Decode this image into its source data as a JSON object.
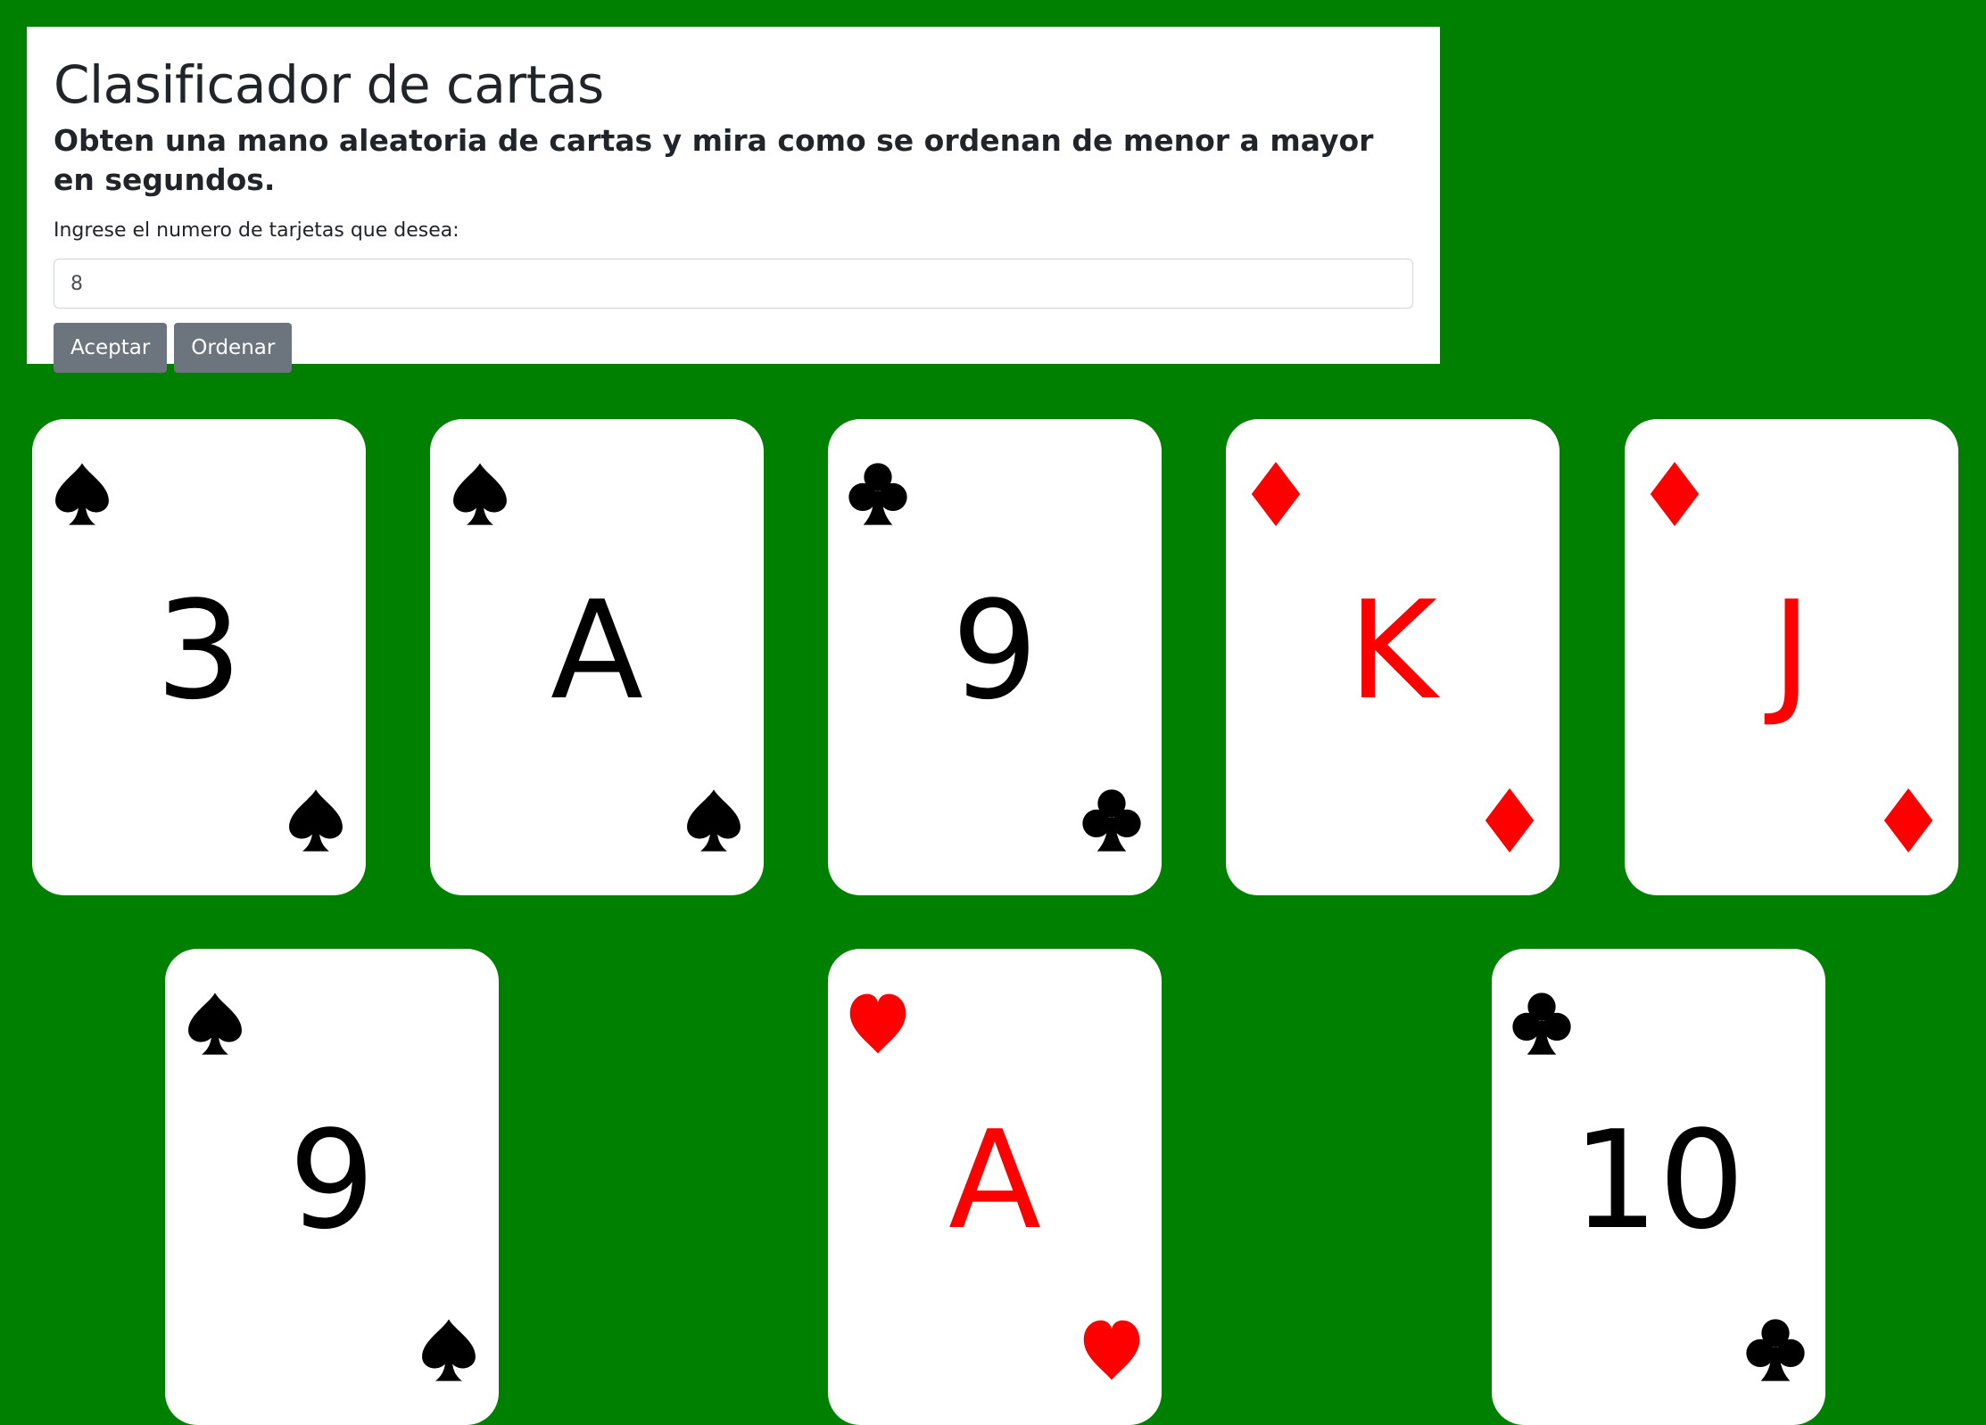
{
  "header": {
    "title": "Clasificador de cartas",
    "subtitle": "Obten una mano aleatoria de cartas y mira como se ordenan de menor a mayor en segundos.",
    "input_label": "Ingrese el numero de tarjetas que desea:",
    "input_value": "8",
    "accept_label": "Aceptar",
    "sort_label": "Ordenar"
  },
  "colors": {
    "background": "#008000",
    "button": "#6c757d",
    "red_suit": "#ff0000",
    "black_suit": "#000000"
  },
  "cards": [
    {
      "rank": "3",
      "suit": "spade-icon",
      "color": "black"
    },
    {
      "rank": "A",
      "suit": "spade-icon",
      "color": "black"
    },
    {
      "rank": "9",
      "suit": "club-icon",
      "color": "black"
    },
    {
      "rank": "K",
      "suit": "diamond-icon",
      "color": "red"
    },
    {
      "rank": "J",
      "suit": "diamond-icon",
      "color": "red"
    },
    {
      "rank": "9",
      "suit": "spade-icon",
      "color": "black"
    },
    {
      "rank": "A",
      "suit": "heart-icon",
      "color": "red"
    },
    {
      "rank": "10",
      "suit": "club-icon",
      "color": "black"
    }
  ]
}
